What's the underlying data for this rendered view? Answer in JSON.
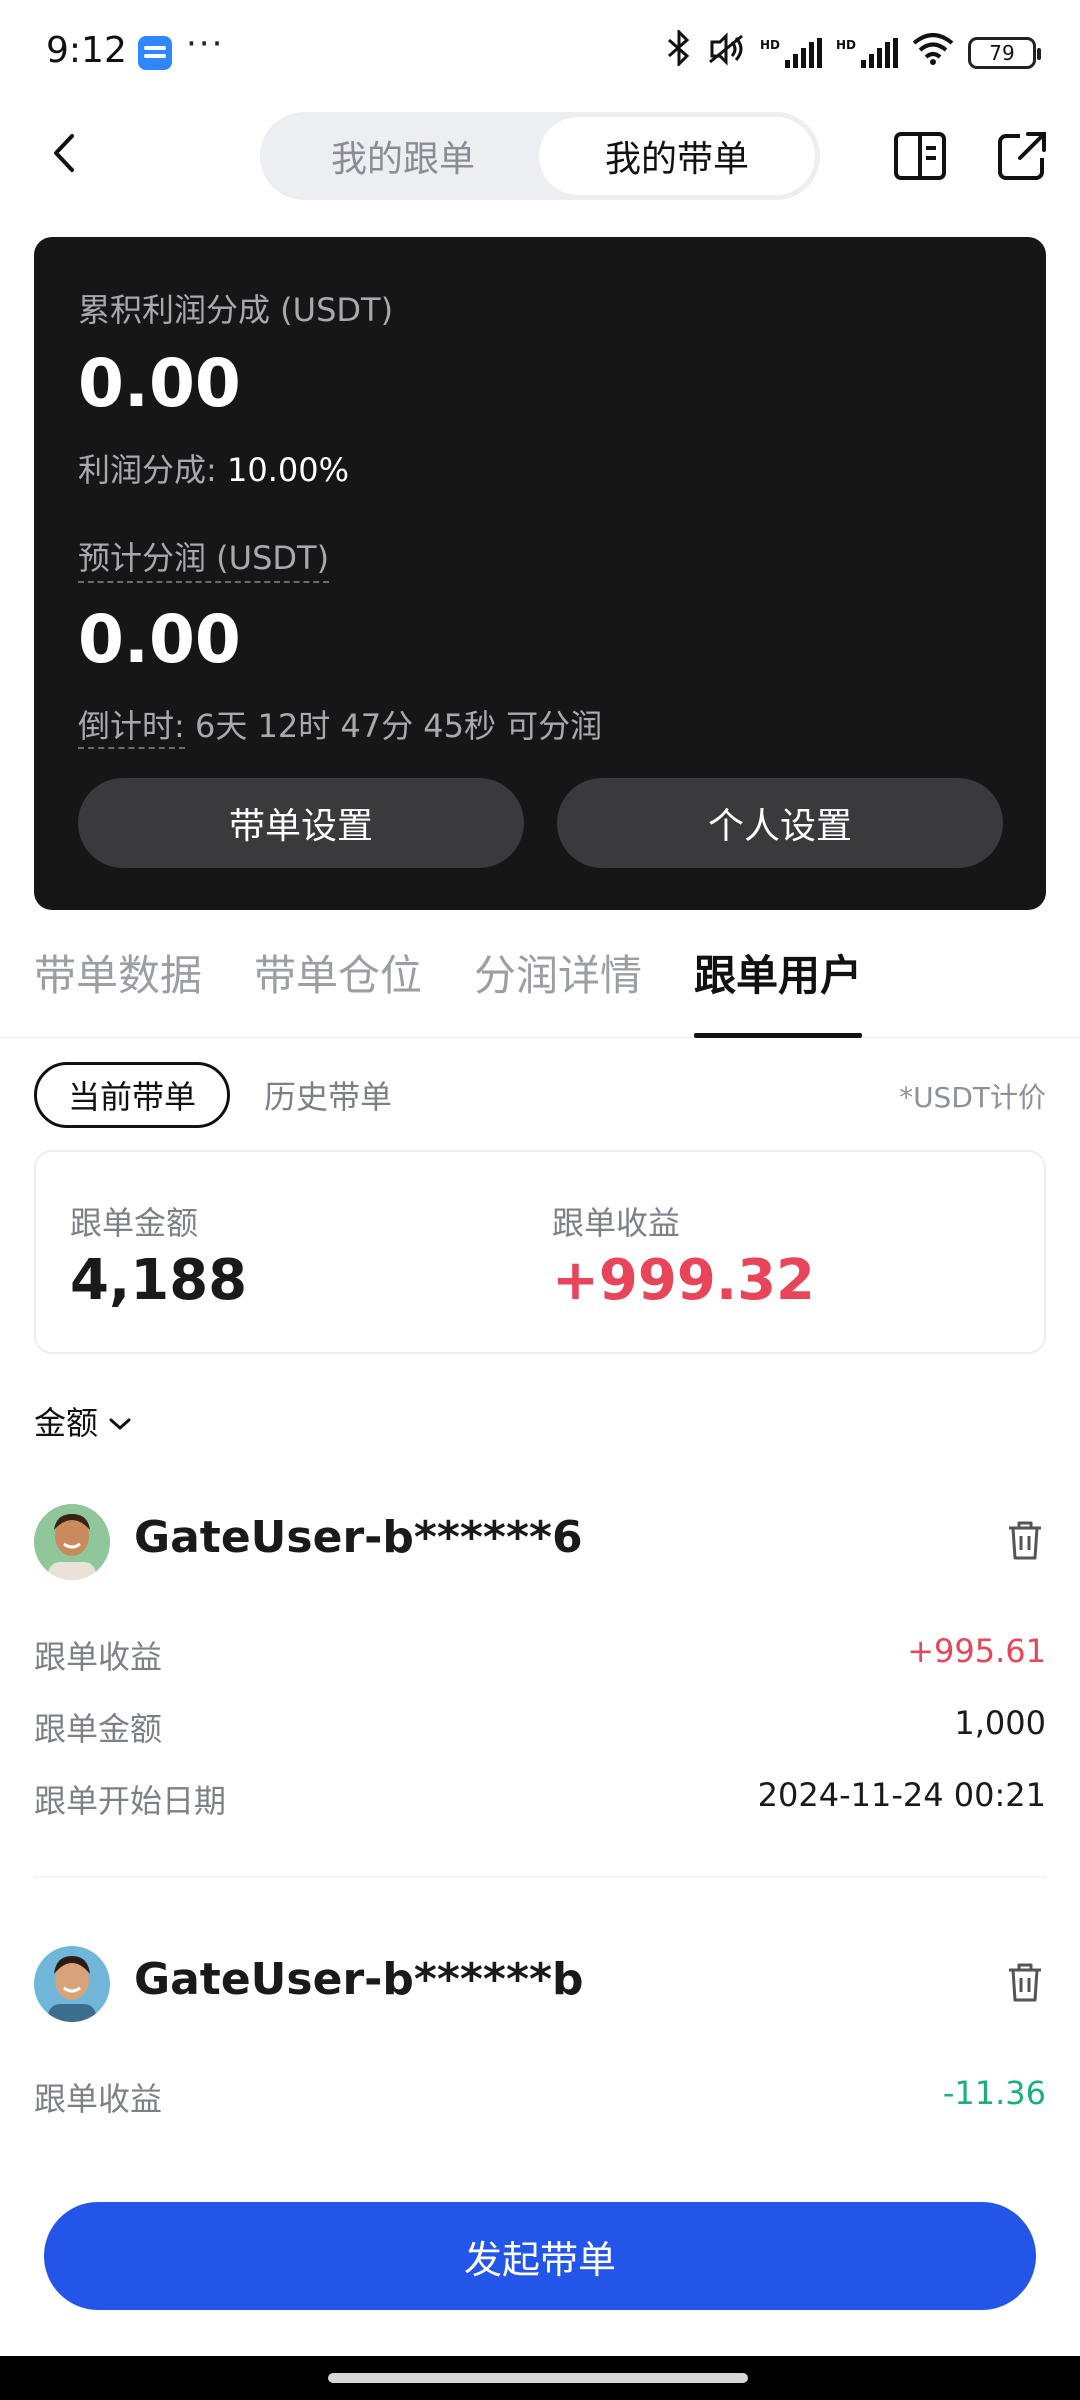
{
  "status_bar": {
    "time": "9:12",
    "dots": "···",
    "battery": "79",
    "icons": [
      "app-icon",
      "bluetooth-icon",
      "mute-icon",
      "signal-icon",
      "signal-icon",
      "wifi-icon",
      "battery-icon"
    ]
  },
  "header": {
    "tab_follow": "我的跟单",
    "tab_lead": "我的带单",
    "active_tab": "我的带单",
    "icons": [
      "back-icon",
      "book-icon",
      "share-icon"
    ]
  },
  "card": {
    "cum_profit_label": "累积利润分成 (USDT)",
    "cum_profit_value": "0.00",
    "profit_share_label": "利润分成: ",
    "profit_share_value": "10.00%",
    "est_label": "预计分润 (USDT)",
    "est_value": "0.00",
    "countdown_label": "倒计时:",
    "countdown_value": " 6天 12时 47分 45秒 可分润",
    "btn_settings": "带单设置",
    "btn_personal": "个人设置"
  },
  "tabs": {
    "items": [
      "带单数据",
      "带单仓位",
      "分润详情",
      "跟单用户"
    ],
    "active": "跟单用户"
  },
  "filter": {
    "current": "当前带单",
    "history": "历史带单",
    "note": "*USDT计价"
  },
  "summary": {
    "amount_label": "跟单金额",
    "amount_value": "4,188",
    "profit_label": "跟单收益",
    "profit_value": "+999.32"
  },
  "sort": {
    "label": "金额"
  },
  "users": [
    {
      "name": "GateUser-b******6",
      "profit_label": "跟单收益",
      "profit_value": "+995.61",
      "amount_label": "跟单金额",
      "amount_value": "1,000",
      "date_label": "跟单开始日期",
      "date_value": "2024-11-24 00:21"
    },
    {
      "name": "GateUser-b******b",
      "profit_label": "跟单收益",
      "profit_value": "-11.36"
    }
  ],
  "cta": {
    "label": "发起带单"
  },
  "colors": {
    "card_bg": "#161616",
    "accent_blue": "#2355e8",
    "profit_red": "#e8455b",
    "loss_green": "#1bb07a"
  }
}
